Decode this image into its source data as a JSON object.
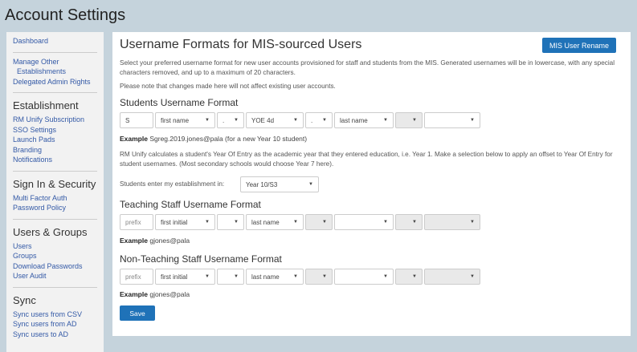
{
  "page_title": "Account Settings",
  "sidebar": {
    "top_links": [
      "Dashboard"
    ],
    "manage_other": "Manage Other",
    "establishments": "Establishments",
    "delegated": "Delegated Admin Rights",
    "sections": [
      {
        "heading": "Establishment",
        "items": [
          "RM Unify Subscription",
          "SSO Settings",
          "Launch Pads",
          "Branding",
          "Notifications"
        ]
      },
      {
        "heading": "Sign In & Security",
        "items": [
          "Multi Factor Auth",
          "Password Policy"
        ]
      },
      {
        "heading": "Users & Groups",
        "items": [
          "Users",
          "Groups",
          "Download Passwords",
          "User Audit"
        ]
      },
      {
        "heading": "Sync",
        "items": [
          "Sync users from CSV",
          "Sync users from AD",
          "Sync users to AD"
        ]
      }
    ]
  },
  "main": {
    "title": "Username Formats for MIS-sourced Users",
    "rename_button": "MIS User Rename",
    "intro": "Select your preferred username format for new user accounts provisioned for staff and students from the MIS. Generated usernames will be in lowercase, with any special characters removed, and up to a maximum of 20 characters.",
    "note": "Please note that changes made here will not affect existing user accounts.",
    "students": {
      "title": "Students Username Format",
      "fields": [
        "S",
        "first name",
        ".",
        "YOE 4d",
        ".",
        "last name",
        "",
        ""
      ],
      "example_label": "Example",
      "example_value": "Sgreg.2019.jones@pala (for a new Year 10 student)",
      "yoe_text": "RM Unify calculates a student's Year Of Entry as the academic year that they entered education, i.e. Year 1. Make a selection below to apply an offset to Year Of Entry for student usernames. (Most secondary schools would choose Year 7 here).",
      "enter_label": "Students enter my establishment in:",
      "enter_value": "Year 10/S3"
    },
    "teaching": {
      "title": "Teaching Staff Username Format",
      "fields": [
        "prefix",
        "first initial",
        "",
        "last name",
        "",
        "",
        "",
        ""
      ],
      "example_label": "Example",
      "example_value": "gjones@pala"
    },
    "nonteaching": {
      "title": "Non-Teaching Staff Username Format",
      "fields": [
        "prefix",
        "first initial",
        "",
        "last name",
        "",
        "",
        "",
        ""
      ],
      "example_label": "Example",
      "example_value": "gjones@pala"
    },
    "save_button": "Save"
  }
}
